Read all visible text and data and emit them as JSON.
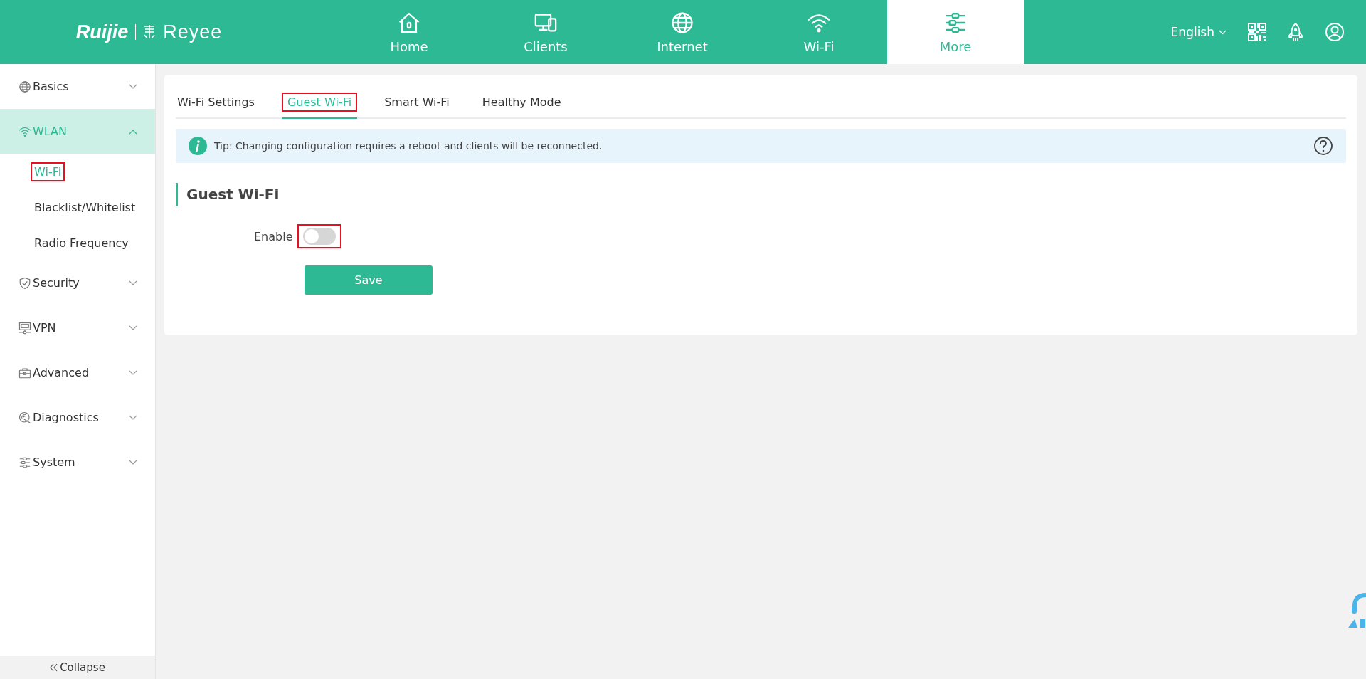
{
  "header": {
    "brand": [
      "Ruijie",
      "Reyee"
    ],
    "nav": [
      {
        "label": "Home",
        "selected": false
      },
      {
        "label": "Clients",
        "selected": false
      },
      {
        "label": "Internet",
        "selected": false
      },
      {
        "label": "Wi-Fi",
        "selected": false
      },
      {
        "label": "More",
        "selected": true
      }
    ],
    "language": "English"
  },
  "sidebar": {
    "items": [
      {
        "label": "Basics",
        "expanded": false,
        "selected": false
      },
      {
        "label": "WLAN",
        "expanded": true,
        "selected": true,
        "children": [
          {
            "label": "Wi-Fi",
            "selected": true,
            "highlighted": true
          },
          {
            "label": "Blacklist/Whitelist",
            "selected": false,
            "highlighted": false
          },
          {
            "label": "Radio Frequency",
            "selected": false,
            "highlighted": false
          }
        ]
      },
      {
        "label": "Security",
        "expanded": false,
        "selected": false
      },
      {
        "label": "VPN",
        "expanded": false,
        "selected": false
      },
      {
        "label": "Advanced",
        "expanded": false,
        "selected": false
      },
      {
        "label": "Diagnostics",
        "expanded": false,
        "selected": false
      },
      {
        "label": "System",
        "expanded": false,
        "selected": false
      }
    ],
    "collapse": "Collapse"
  },
  "content": {
    "tabs": [
      {
        "label": "Wi-Fi Settings",
        "selected": false,
        "highlighted": false
      },
      {
        "label": "Guest Wi-Fi",
        "selected": true,
        "highlighted": true
      },
      {
        "label": "Smart Wi-Fi",
        "selected": false,
        "highlighted": false
      },
      {
        "label": "Healthy Mode",
        "selected": false,
        "highlighted": false
      }
    ],
    "tip": "Tip: Changing configuration requires a reboot and clients will be reconnected.",
    "section_title": "Guest Wi-Fi",
    "enable": {
      "label": "Enable",
      "on": false,
      "highlighted": true
    },
    "save": "Save"
  }
}
